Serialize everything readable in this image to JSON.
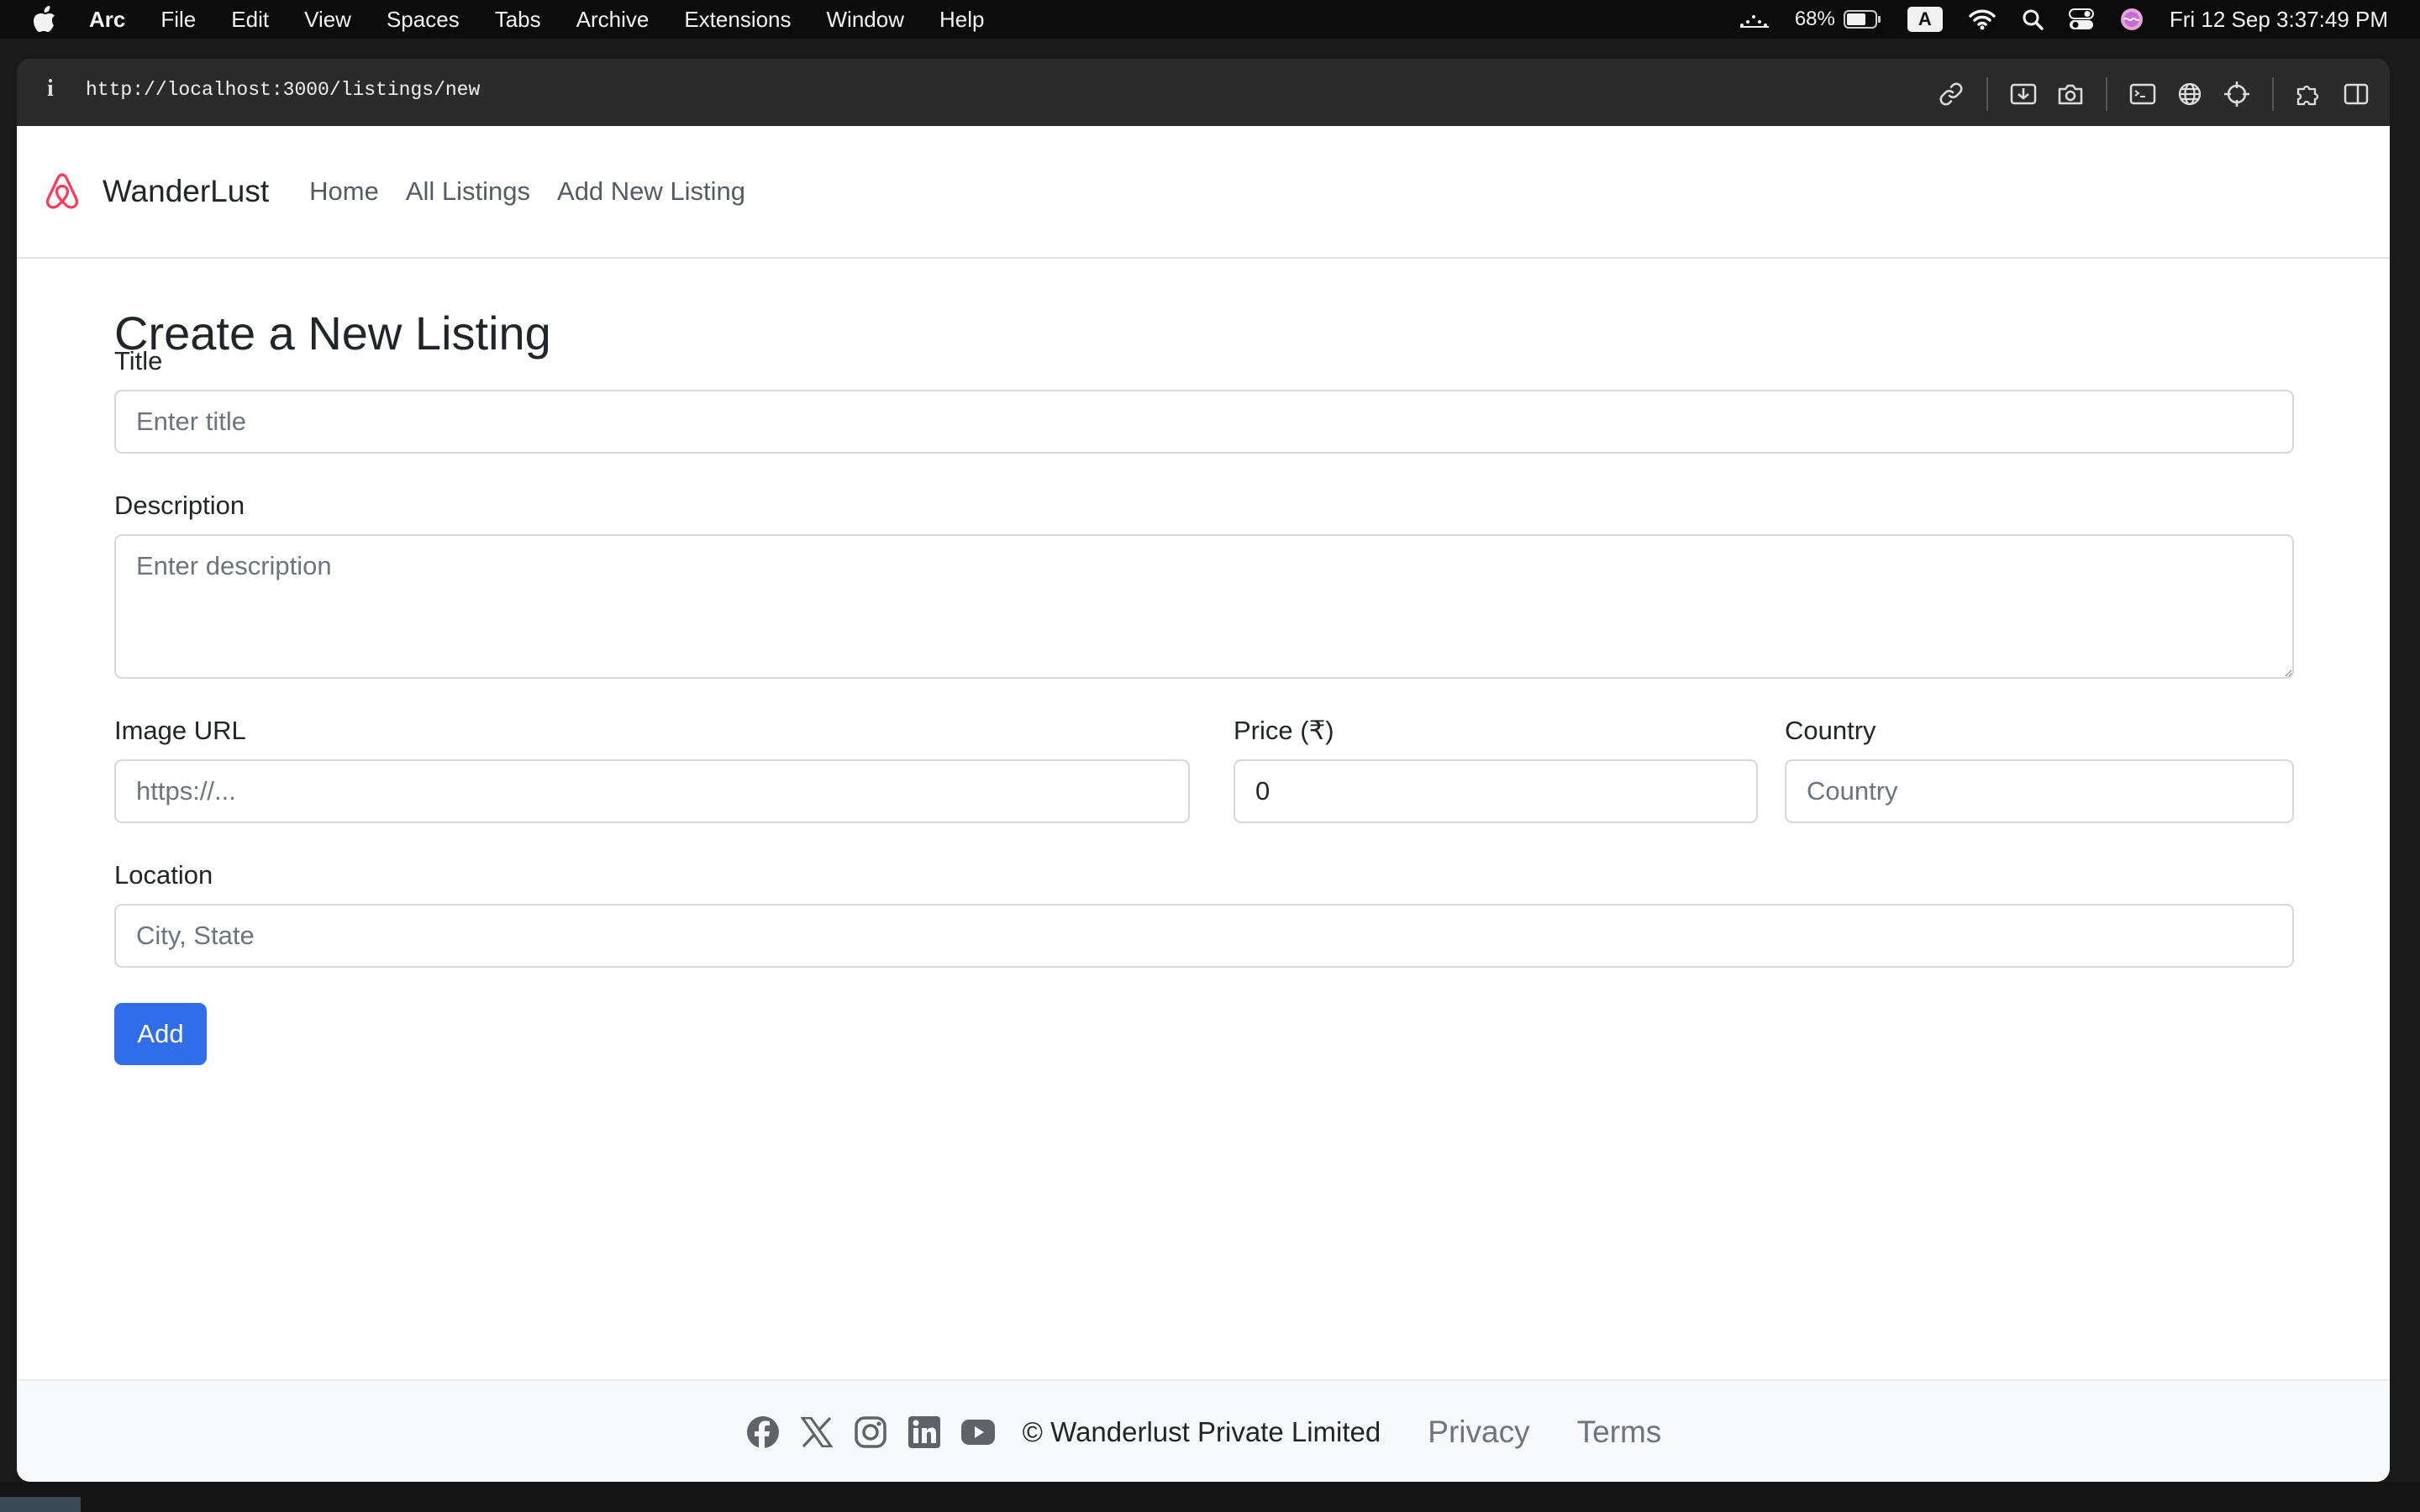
{
  "menubar": {
    "app_name": "Arc",
    "items": [
      "File",
      "Edit",
      "View",
      "Spaces",
      "Tabs",
      "Archive",
      "Extensions",
      "Window",
      "Help"
    ],
    "battery": "68%",
    "input_source": "A",
    "clock": "Fri 12 Sep  3:37:49 PM"
  },
  "browser": {
    "url": "http://localhost:3000/listings/new",
    "info_glyph": "i"
  },
  "navbar": {
    "brand": "WanderLust",
    "links": [
      "Home",
      "All Listings",
      "Add New Listing"
    ]
  },
  "form": {
    "heading": "Create a New Listing",
    "title_label": "Title",
    "title_placeholder": "Enter title",
    "description_label": "Description",
    "description_placeholder": "Enter description",
    "image_label": "Image URL",
    "image_placeholder": "https://...",
    "price_label": "Price (₹)",
    "price_value": "0",
    "country_label": "Country",
    "country_placeholder": "Country",
    "location_label": "Location",
    "location_placeholder": "City, State",
    "submit_label": "Add"
  },
  "footer": {
    "social_icons": [
      "facebook-icon",
      "x-icon",
      "instagram-icon",
      "linkedin-icon",
      "youtube-icon"
    ],
    "copyright": "© Wanderlust Private Limited",
    "links": [
      "Privacy",
      "Terms"
    ]
  },
  "colors": {
    "brand_accent": "#ff385c",
    "primary_button": "#2f6ee8"
  }
}
